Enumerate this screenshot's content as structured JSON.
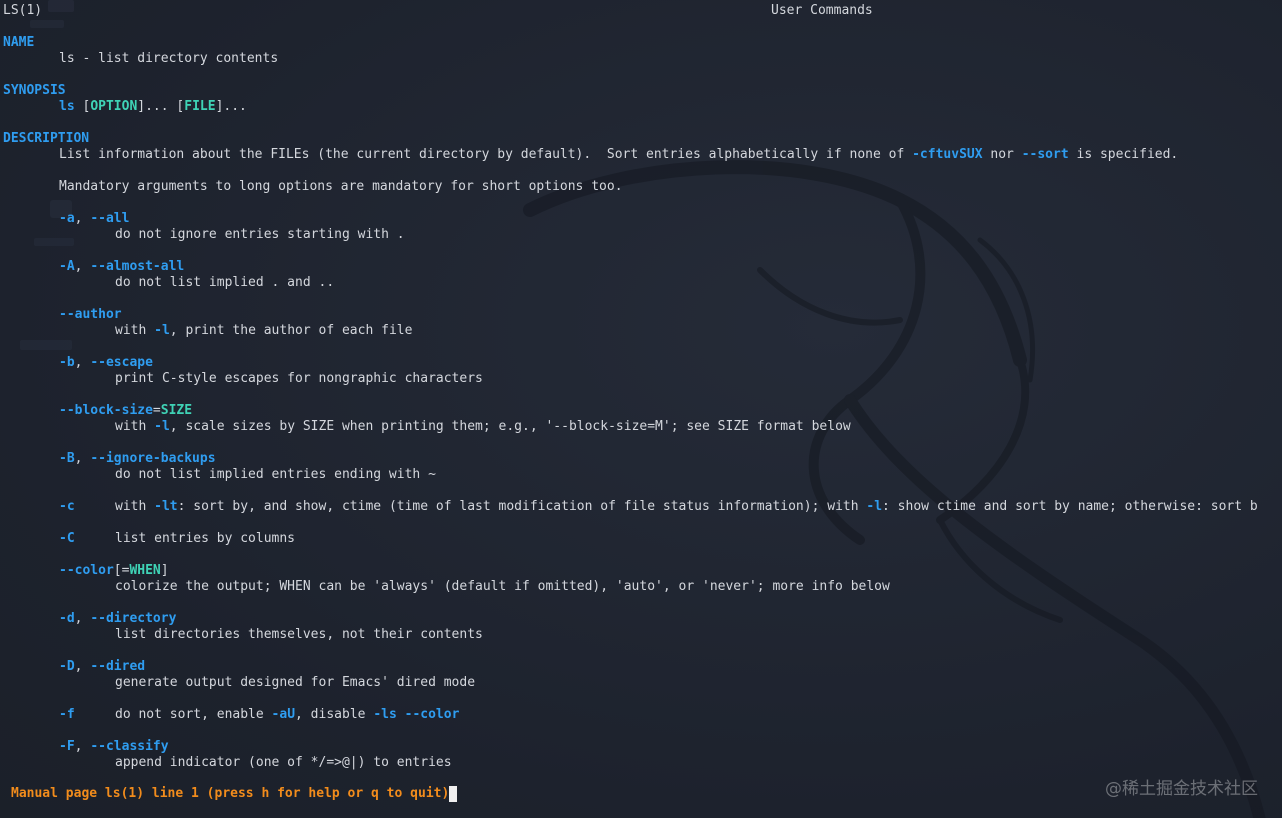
{
  "header": {
    "left": "LS(1)",
    "center": "User Commands"
  },
  "sections": {
    "name_title": "NAME",
    "name_text": "ls - list directory contents",
    "synopsis_title": "SYNOPSIS",
    "synopsis": {
      "cmd": "ls",
      "open1": " [",
      "option": "OPTION",
      "close1": "]... ",
      "open2": "[",
      "file": "FILE",
      "close2": "]..."
    },
    "description_title": "DESCRIPTION",
    "desc": {
      "p1_a": "List information about the FILEs (the current directory by default).  Sort entries alphabetically if none of ",
      "p1_opt": "-cftuvSUX",
      "p1_b": " nor ",
      "p1_opt2": "--sort",
      "p1_c": " is specified.",
      "p2": "Mandatory arguments to long options are mandatory for short options too."
    }
  },
  "options": {
    "a_short": "-a",
    "a_long": "--all",
    "a_desc": "do not ignore entries starting with .",
    "A_short": "-A",
    "A_long": "--almost-all",
    "A_desc": "do not list implied . and ..",
    "author_long": "--author",
    "author_desc_a": "with ",
    "author_desc_opt": "-l",
    "author_desc_b": ", print the author of each file",
    "b_short": "-b",
    "b_long": "--escape",
    "b_desc": "print C-style escapes for nongraphic characters",
    "bs_long": "--block-size",
    "bs_eq": "=",
    "bs_arg": "SIZE",
    "bs_desc_a": "with ",
    "bs_desc_opt": "-l",
    "bs_desc_b": ", scale sizes by SIZE when printing them; e.g., '--block-size=M'; see SIZE format below",
    "B_short": "-B",
    "B_long": "--ignore-backups",
    "B_desc": "do not list implied entries ending with ~",
    "c_short": "-c",
    "c_desc_a": "with ",
    "c_desc_opt1": "-lt",
    "c_desc_b": ": sort by, and show, ctime (time of last modification of file status information); with ",
    "c_desc_opt2": "-l",
    "c_desc_c": ": show ctime and sort by name; otherwise: sort b",
    "C_short": "-C",
    "C_desc": "list entries by columns",
    "color_long": "--color",
    "color_open": "[=",
    "color_arg": "WHEN",
    "color_close": "]",
    "color_desc": "colorize the output; WHEN can be 'always' (default if omitted), 'auto', or 'never'; more info below",
    "d_short": "-d",
    "d_long": "--directory",
    "d_desc": "list directories themselves, not their contents",
    "D_short": "-D",
    "D_long": "--dired",
    "D_desc": "generate output designed for Emacs' dired mode",
    "f_short": "-f",
    "f_desc_a": "do not sort, enable ",
    "f_desc_opt1": "-aU",
    "f_desc_b": ", disable ",
    "f_desc_opt2": "-ls",
    "f_desc_c": " ",
    "f_desc_opt3": "--color",
    "F_short": "-F",
    "F_long": "--classify",
    "F_desc": "append indicator (one of */=>@|) to entries",
    "sep": ", "
  },
  "status_bar": {
    "text": "Manual page ls(1) line 1 (press h for help or q to quit)"
  },
  "watermark": "@稀土掘金技术社区",
  "colors": {
    "background": "#1f2430",
    "text": "#d4d7dd",
    "option": "#2f9df0",
    "argument": "#3fd3b6",
    "status": "#f28c1c"
  }
}
